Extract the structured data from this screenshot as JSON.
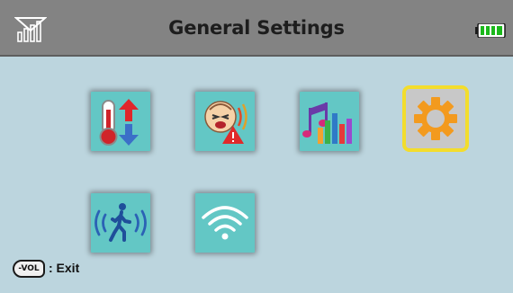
{
  "header": {
    "title": "General Settings"
  },
  "status": {
    "signal_icon": "signal-strength-icon",
    "battery_icon": "battery-full-icon"
  },
  "tiles": [
    {
      "name": "temperature-icon",
      "selected": false
    },
    {
      "name": "cry-alert-icon",
      "selected": false
    },
    {
      "name": "music-icon",
      "selected": false
    },
    {
      "name": "settings-gear-icon",
      "selected": true
    },
    {
      "name": "motion-detection-icon",
      "selected": false
    },
    {
      "name": "wifi-icon",
      "selected": false
    }
  ],
  "footer": {
    "key_label": "-VOL",
    "key_icon": "vol-minus-key-icon",
    "action_label": ": Exit"
  },
  "colors": {
    "header_bg": "#838383",
    "screen_bg": "#bcd5de",
    "tile_bg": "#63c7c5",
    "selection": "#f3dd2c"
  }
}
